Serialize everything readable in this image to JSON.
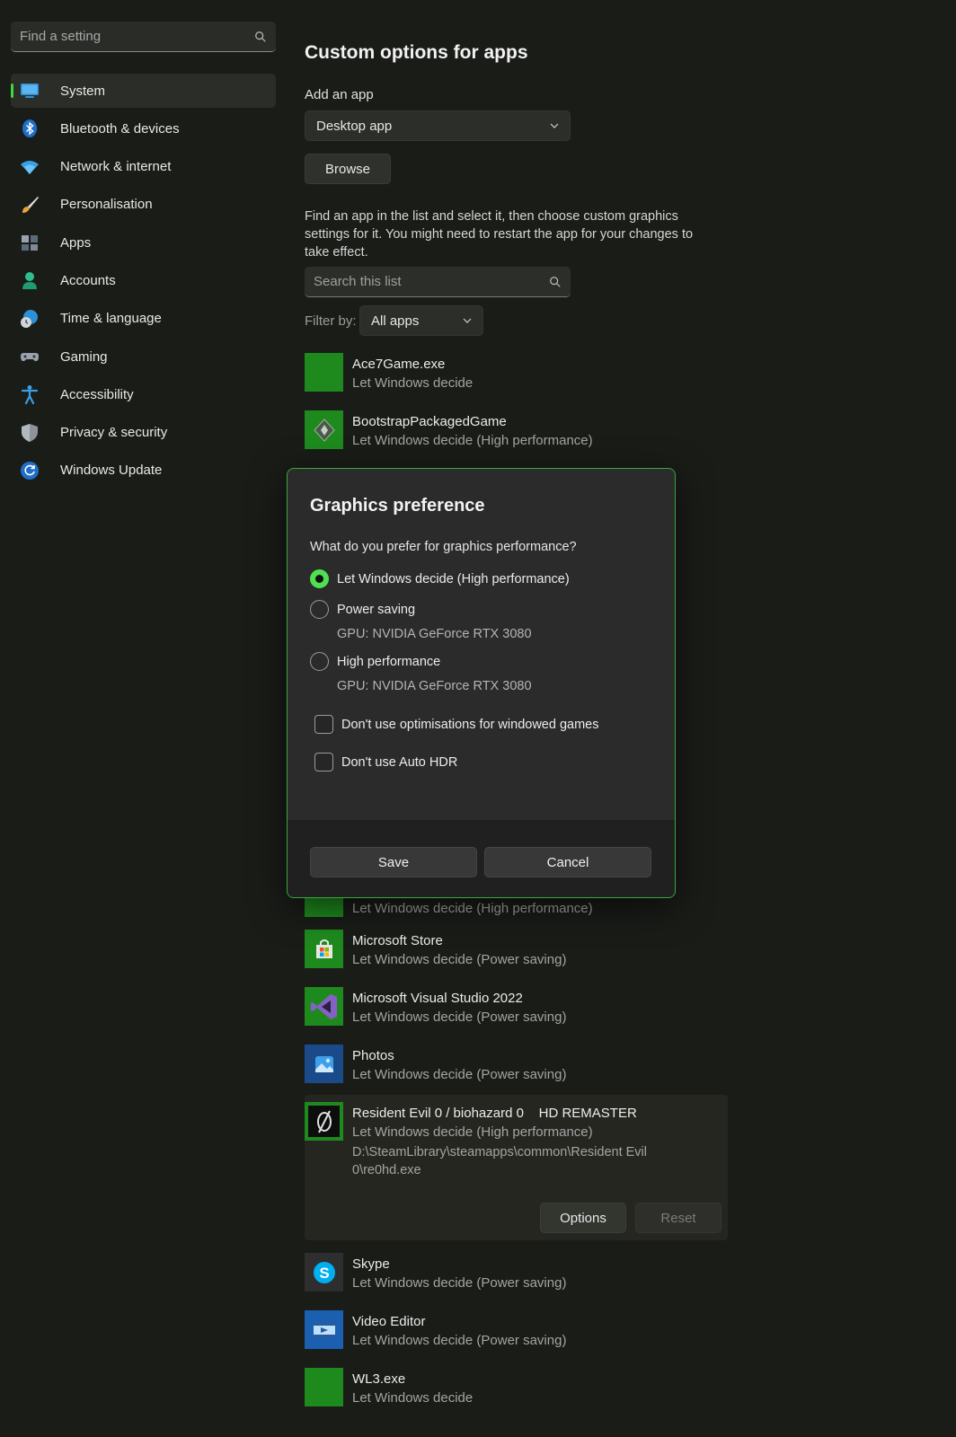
{
  "sidebar": {
    "search_placeholder": "Find a setting",
    "items": [
      {
        "label": "System",
        "icon": "monitor-icon",
        "active": true
      },
      {
        "label": "Bluetooth & devices",
        "icon": "bluetooth-icon"
      },
      {
        "label": "Network & internet",
        "icon": "wifi-icon"
      },
      {
        "label": "Personalisation",
        "icon": "brush-icon"
      },
      {
        "label": "Apps",
        "icon": "apps-icon"
      },
      {
        "label": "Accounts",
        "icon": "person-icon"
      },
      {
        "label": "Time & language",
        "icon": "globe-clock-icon"
      },
      {
        "label": "Gaming",
        "icon": "gamepad-icon"
      },
      {
        "label": "Accessibility",
        "icon": "accessibility-icon"
      },
      {
        "label": "Privacy & security",
        "icon": "shield-icon"
      },
      {
        "label": "Windows Update",
        "icon": "refresh-icon"
      }
    ]
  },
  "main": {
    "title": "Custom options for apps",
    "add_app_label": "Add an app",
    "app_type_selected": "Desktop app",
    "browse_label": "Browse",
    "description": "Find an app in the list and select it, then choose custom graphics settings for it. You might need to restart the app for your changes to take effect.",
    "list_search_placeholder": "Search this list",
    "filter_label": "Filter by:",
    "filter_selected": "All apps"
  },
  "apps": [
    {
      "name": "Ace7Game.exe",
      "status": "Let Windows decide",
      "icon": "green-tile-icon"
    },
    {
      "name": "BootstrapPackagedGame",
      "status": "Let Windows decide (High performance)",
      "icon": "bootstrap-game-icon"
    },
    {
      "name": "",
      "status": "Let Windows decide (High performance)",
      "icon": "green-tile-icon"
    },
    {
      "name": "Microsoft Store",
      "status": "Let Windows decide (Power saving)",
      "icon": "store-icon"
    },
    {
      "name": "Microsoft Visual Studio 2022",
      "status": "Let Windows decide (Power saving)",
      "icon": "visual-studio-icon"
    },
    {
      "name": "Photos",
      "status": "Let Windows decide (Power saving)",
      "icon": "photos-icon"
    },
    {
      "name": "Skype",
      "status": "Let Windows decide (Power saving)",
      "icon": "skype-icon"
    },
    {
      "name": "Video Editor",
      "status": "Let Windows decide (Power saving)",
      "icon": "video-editor-icon"
    },
    {
      "name": "WL3.exe",
      "status": "Let Windows decide",
      "icon": "green-tile-icon"
    }
  ],
  "selected_app": {
    "name": "Resident Evil 0 / biohazard 0    HD REMASTER",
    "status": "Let Windows decide (High performance)",
    "path": "D:\\SteamLibrary\\steamapps\\common\\Resident Evil 0\\re0hd.exe",
    "options_label": "Options",
    "reset_label": "Reset",
    "icon": "resident-evil-icon"
  },
  "dialog": {
    "title": "Graphics preference",
    "question": "What do you prefer for graphics performance?",
    "options": [
      {
        "label": "Let Windows decide (High performance)",
        "checked": true
      },
      {
        "label": "Power saving",
        "gpu": "GPU: NVIDIA GeForce RTX 3080",
        "checked": false
      },
      {
        "label": "High performance",
        "gpu": "GPU: NVIDIA GeForce RTX 3080",
        "checked": false
      }
    ],
    "checkboxes": [
      {
        "label": "Don't use optimisations for windowed games",
        "checked": false
      },
      {
        "label": "Don't use Auto HDR",
        "checked": false
      }
    ],
    "save_label": "Save",
    "cancel_label": "Cancel"
  },
  "colors": {
    "accent": "#4ee04e",
    "background": "#1a1c18",
    "dialog_border": "#3aa83a"
  }
}
